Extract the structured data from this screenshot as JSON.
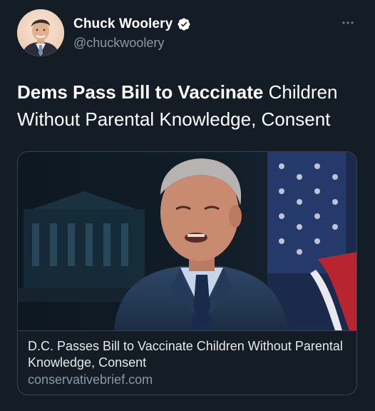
{
  "author": {
    "display_name": "Chuck Woolery",
    "handle": "@chuckwoolery",
    "verified": true,
    "avatar_icon": "profile-photo"
  },
  "menu": {
    "more_icon": "more-horizontal-icon"
  },
  "tweet": {
    "text_bold": "Dems Pass Bill to Vaccinate",
    "text_rest": " Children Without Parental Knowledge, Consent"
  },
  "card": {
    "image_icon": "article-photo",
    "title": "D.C. Passes Bill to Vaccinate Children Without Parental Knowledge, Consent",
    "domain": "conservativebrief.com"
  },
  "colors": {
    "background": "#141d26",
    "primary_text": "#ffffff",
    "secondary_text": "#8b98a5",
    "border": "#38444d",
    "verified_badge": "#ffffff"
  }
}
